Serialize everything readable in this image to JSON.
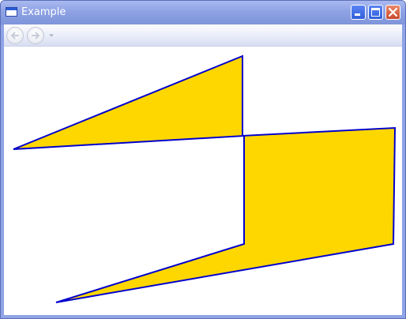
{
  "window": {
    "title": "Example",
    "icons": {
      "app": "window-icon",
      "minimize": "minimize-icon",
      "maximize": "maximize-icon",
      "close": "close-icon"
    }
  },
  "navigation": {
    "back_icon": "back-arrow-icon",
    "forward_icon": "forward-arrow-icon",
    "history_icon": "chevron-down-icon"
  },
  "shape": {
    "fill_color": "#FFD700",
    "stroke_color": "#0000CD"
  }
}
